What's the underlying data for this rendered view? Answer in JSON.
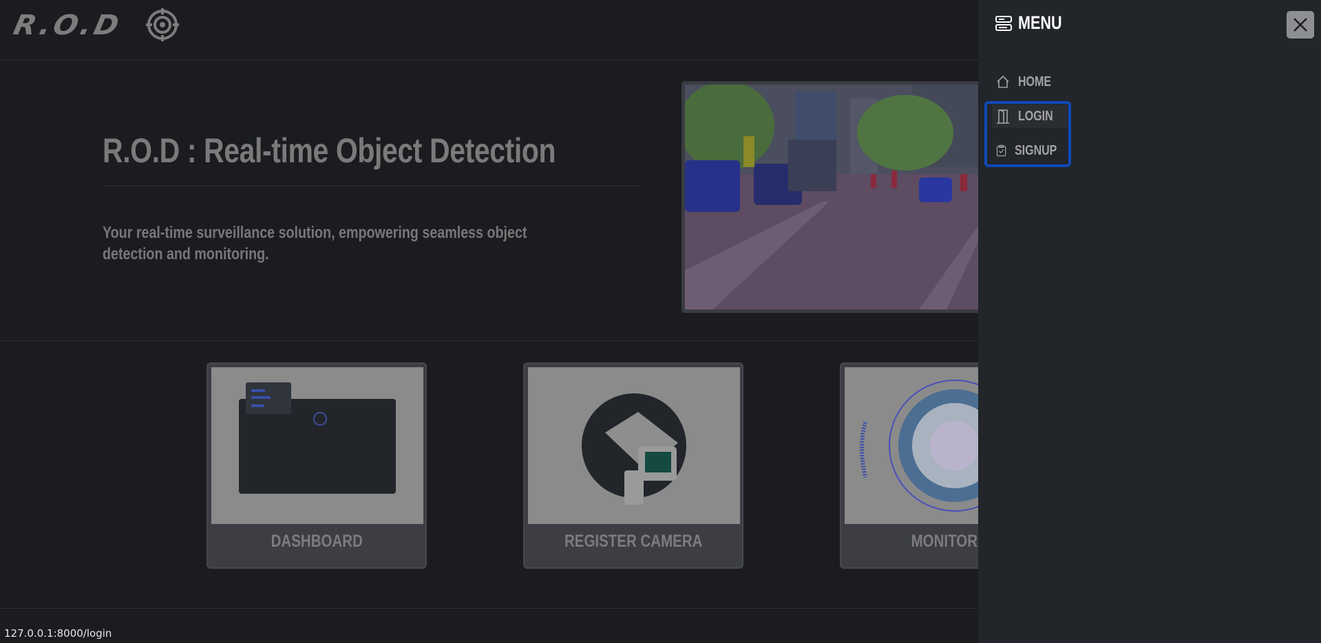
{
  "header": {
    "logo_text": "R.O.D"
  },
  "hero": {
    "title": "R.O.D : Real-time Object Detection",
    "subtitle": "Your real-time surveillance solution, empowering seamless object detection and monitoring."
  },
  "cards": [
    {
      "label": "DASHBOARD"
    },
    {
      "label": "REGISTER CAMERA"
    },
    {
      "label": "MONITOR"
    }
  ],
  "status_bar": {
    "url": "127.0.0.1:8000/login"
  },
  "menu": {
    "title": "MENU",
    "items": [
      {
        "label": "HOME",
        "icon": "home-icon"
      },
      {
        "label": "LOGIN",
        "icon": "door-icon"
      },
      {
        "label": "SIGNUP",
        "icon": "clipboard-check-icon"
      }
    ]
  },
  "colors": {
    "highlight": "#1049b8",
    "menu_bg": "#22252a",
    "page_bg": "#1a1c20"
  }
}
